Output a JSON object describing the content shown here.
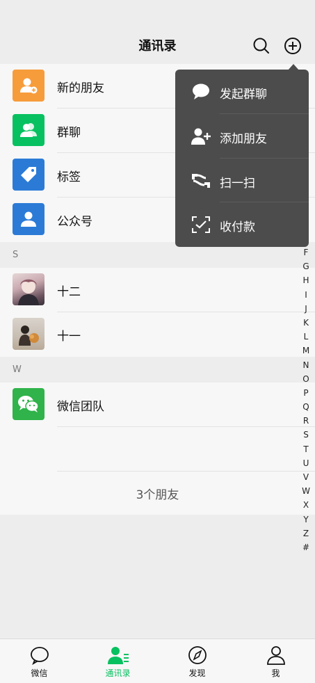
{
  "header": {
    "title": "通讯录",
    "search_icon": "search-icon",
    "add_icon": "plus-circle-icon"
  },
  "top_items": [
    {
      "label": "新的朋友",
      "color": "#f79c3b",
      "icon": "add-friend-icon"
    },
    {
      "label": "群聊",
      "color": "#07c160",
      "icon": "group-icon"
    },
    {
      "label": "标签",
      "color": "#2b7bd6",
      "icon": "tag-icon"
    },
    {
      "label": "公众号",
      "color": "#2b7bd6",
      "icon": "official-account-icon"
    }
  ],
  "sections": [
    {
      "letter": "S",
      "contacts": [
        {
          "name": "十二"
        },
        {
          "name": "十一"
        }
      ]
    },
    {
      "letter": "W",
      "contacts": [
        {
          "name": "微信团队"
        }
      ]
    }
  ],
  "friend_count": "3个朋友",
  "index_letters": [
    "F",
    "G",
    "H",
    "I",
    "J",
    "K",
    "L",
    "M",
    "N",
    "O",
    "P",
    "Q",
    "R",
    "S",
    "T",
    "U",
    "V",
    "W",
    "X",
    "Y",
    "Z",
    "#"
  ],
  "popup_menu": {
    "items": [
      {
        "label": "发起群聊",
        "icon": "chat-bubble-icon"
      },
      {
        "label": "添加朋友",
        "icon": "add-person-icon"
      },
      {
        "label": "扫一扫",
        "icon": "scan-icon"
      },
      {
        "label": "收付款",
        "icon": "payment-icon"
      }
    ]
  },
  "tabbar": {
    "items": [
      {
        "label": "微信",
        "icon": "chat-icon",
        "active": false
      },
      {
        "label": "通讯录",
        "icon": "contacts-icon",
        "active": true
      },
      {
        "label": "发现",
        "icon": "compass-icon",
        "active": false
      },
      {
        "label": "我",
        "icon": "person-icon",
        "active": false
      }
    ]
  },
  "colors": {
    "accent": "#07c160",
    "menu_bg": "#4c4c4c"
  }
}
